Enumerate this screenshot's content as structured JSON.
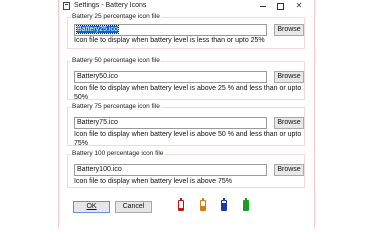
{
  "window": {
    "title": "Settings - Battery Icons",
    "minimize_icon": "minimize-icon",
    "maximize_icon": "maximize-icon",
    "close_icon": "close-icon",
    "close_glyph": "✕"
  },
  "groups": [
    {
      "label": "Battery 25 percentage icon file",
      "value": "Battery25.ico",
      "selected": true,
      "browse_label": "Browse",
      "description": "Icon file to display when battery level is less than or upto 25%"
    },
    {
      "label": "Battery 50 percentage icon file",
      "value": "Battery50.ico",
      "selected": false,
      "browse_label": "Browse",
      "description": "Icon file to display when battery level is above 25 % and less than or upto 50%"
    },
    {
      "label": "Battery 75 percentage icon file",
      "value": "Battery75.ico",
      "selected": false,
      "browse_label": "Browse",
      "description": "Icon file to display when battery level is above 50 % and less than or upto 75%"
    },
    {
      "label": "Battery 100 percentage icon file",
      "value": "Battery100.ico",
      "selected": false,
      "browse_label": "Browse",
      "description": "Icon file to display when battery level is above 75%"
    }
  ],
  "buttons": {
    "ok_label": "OK",
    "cancel_label": "Cancel"
  },
  "battery_icons": [
    {
      "name": "battery-25-icon",
      "level": 0.25,
      "color": "#c01818"
    },
    {
      "name": "battery-50-icon",
      "level": 0.5,
      "color": "#d08010"
    },
    {
      "name": "battery-75-icon",
      "level": 0.75,
      "color": "#1a3aa8"
    },
    {
      "name": "battery-100-icon",
      "level": 1.0,
      "color": "#1e9b26"
    }
  ]
}
